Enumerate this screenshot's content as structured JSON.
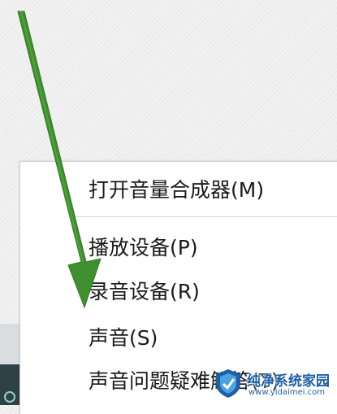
{
  "context_menu": {
    "items": [
      {
        "label": "打开音量合成器(M)"
      },
      {
        "label": "播放设备(P)"
      },
      {
        "label": "录音设备(R)"
      },
      {
        "label": "声音(S)"
      },
      {
        "label": "声音问题疑难解答(T)"
      }
    ]
  },
  "annotation": {
    "arrow_color": "#3f8f2f",
    "arrow_icon": "arrow-down-icon"
  },
  "watermark": {
    "title": "纯净系统家园",
    "url": "www.yidaimei.com",
    "logo_icon": "shield-logo-icon",
    "color": "#1e5fa8"
  }
}
